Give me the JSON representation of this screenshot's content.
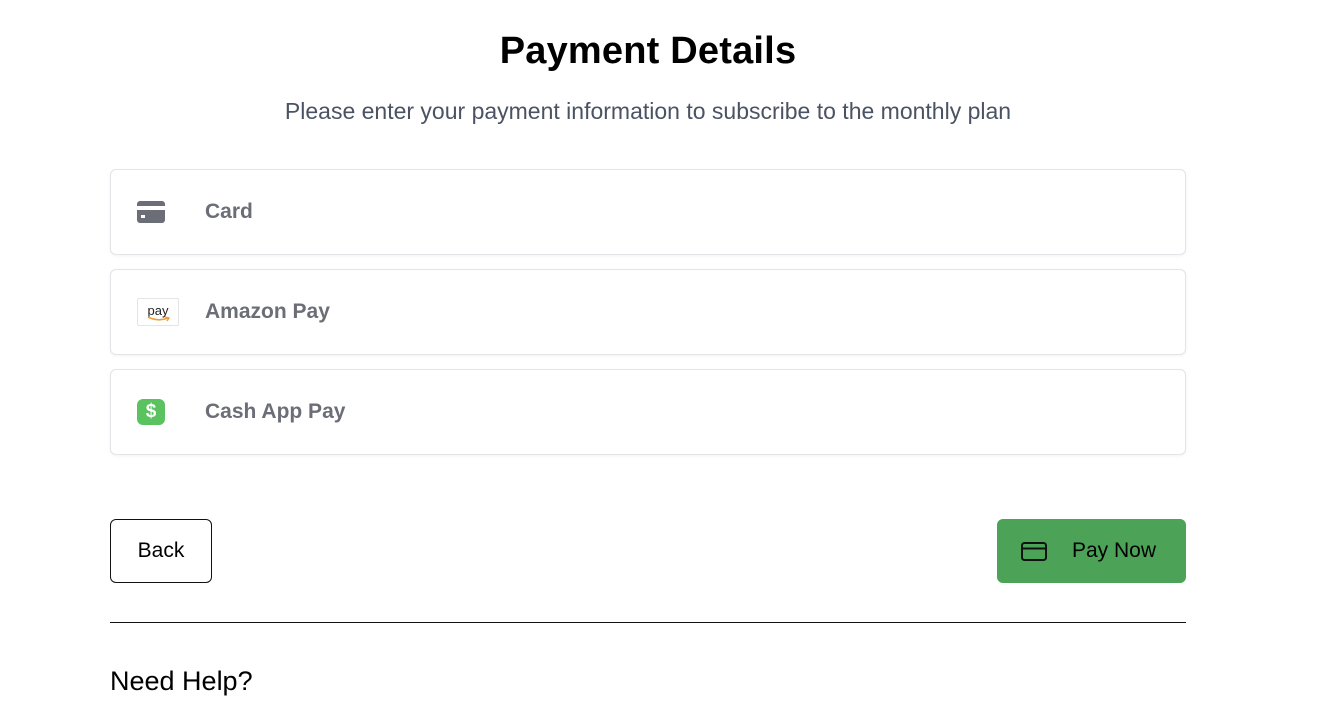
{
  "header": {
    "title": "Payment Details",
    "subtitle": "Please enter your payment information to subscribe to the monthly plan"
  },
  "payment_methods": [
    {
      "label": "Card",
      "icon": "credit-card-icon"
    },
    {
      "label": "Amazon Pay",
      "icon": "amazon-pay-logo",
      "logo_text": "pay"
    },
    {
      "label": "Cash App Pay",
      "icon": "cash-app-logo",
      "logo_text": "$"
    }
  ],
  "actions": {
    "back_label": "Back",
    "pay_label": "Pay Now",
    "pay_icon": "credit-card-outline-icon"
  },
  "help": {
    "title": "Need Help?"
  },
  "colors": {
    "pay_button": "#4ca357",
    "cash_app_green": "#5ac25f",
    "amazon_orange": "#f29d38",
    "method_label": "#6b6e77",
    "subtitle": "#4a5363"
  }
}
